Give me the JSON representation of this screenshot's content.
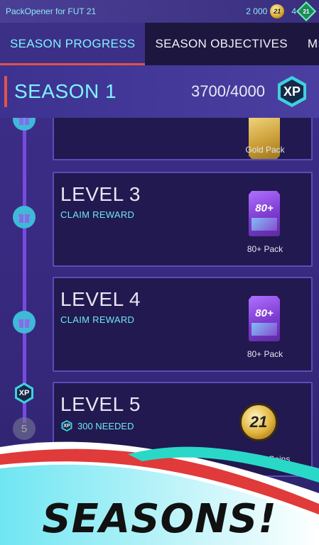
{
  "topbar": {
    "app_title": "PackOpener for FUT 21",
    "coins": "2 000",
    "coin_badge": "21",
    "gems": "4",
    "gem_badge": "21"
  },
  "tabs": [
    {
      "label": "SEASON PROGRESS",
      "active": true
    },
    {
      "label": "SEASON OBJECTIVES",
      "active": false
    },
    {
      "label": "MILESTONES",
      "active": false
    }
  ],
  "season": {
    "title": "SEASON 1",
    "progress": "3700/4000",
    "xp_badge": "XP"
  },
  "levels": [
    {
      "reward": "Gold Pack"
    },
    {
      "title": "LEVEL 3",
      "status": "CLAIM REWARD",
      "pack_text": "80+",
      "reward": "80+ Pack"
    },
    {
      "title": "LEVEL 4",
      "status": "CLAIM REWARD",
      "pack_text": "80+",
      "reward": "80+ Pack"
    },
    {
      "title": "LEVEL 5",
      "status": "300 NEEDED",
      "xp_mini": "XP",
      "coin_text": "21",
      "reward": "10 000 Coins"
    }
  ],
  "timeline": {
    "xp_node": "XP",
    "next_number": "5"
  },
  "promo_text": "SEASONS!",
  "colors": {
    "accent_cyan": "#7ff3ff",
    "accent_red": "#e0534a",
    "card_bg": "#21194f",
    "background": "#3b2d86"
  }
}
